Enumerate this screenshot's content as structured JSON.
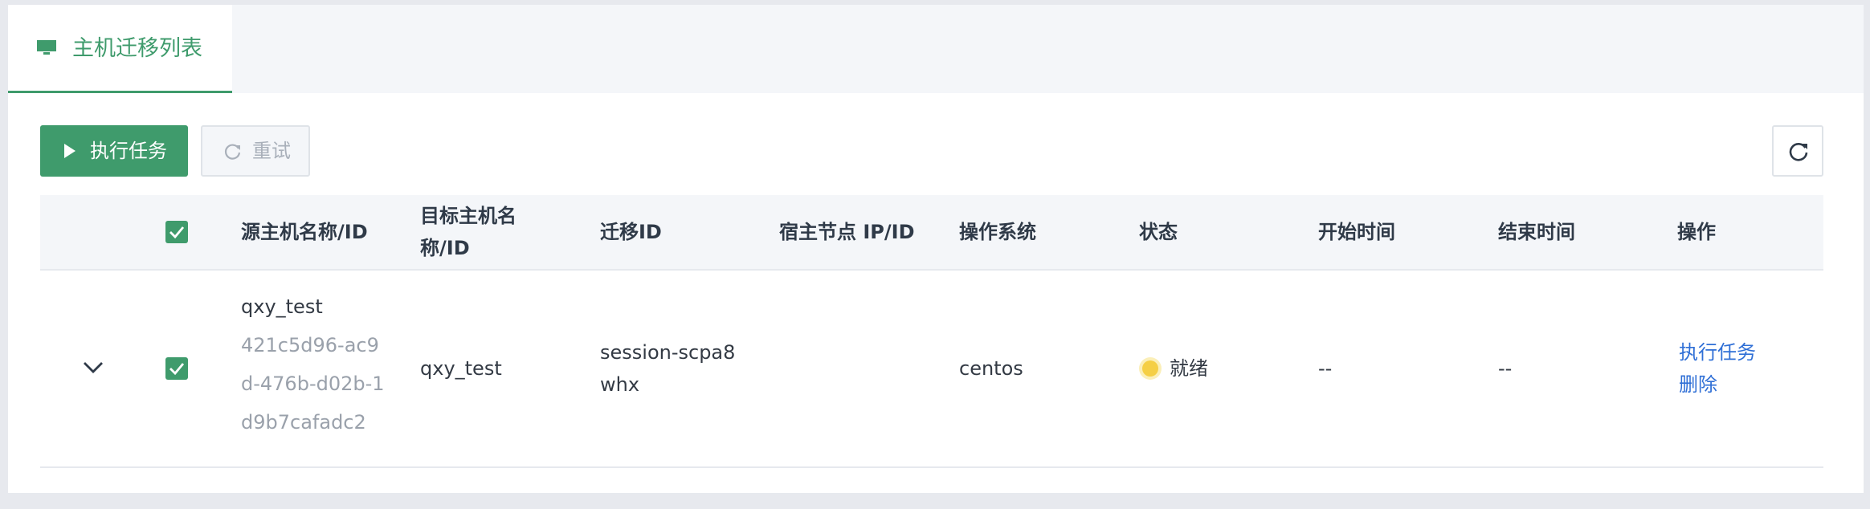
{
  "tab": {
    "title": "主机迁移列表",
    "icon": "monitor-icon"
  },
  "toolbar": {
    "run_label": "执行任务",
    "retry_label": "重试",
    "refresh_icon": "refresh-icon"
  },
  "table": {
    "columns": [
      "源主机名称/ID",
      "目标主机名",
      "称/ID",
      "迁移ID",
      "宿主节点 IP/ID",
      "操作系统",
      "状态",
      "开始时间",
      "结束时间",
      "操作"
    ],
    "rows": [
      {
        "source_name": "qxy_test",
        "source_id_lines": [
          "421c5d96-ac9",
          "d-476b-d02b-1",
          "d9b7cafadc2"
        ],
        "target_name": "qxy_test",
        "migration_id_lines": [
          "session-scpa8",
          "whx"
        ],
        "host_node": "",
        "os": "centos",
        "status": "就绪",
        "start_time": "--",
        "end_time": "--",
        "actions": [
          "执行任务",
          "删除"
        ]
      }
    ]
  },
  "colors": {
    "accent": "#3f9b6c",
    "link": "#2f6fd6",
    "status_ready": "#f5cf45"
  }
}
